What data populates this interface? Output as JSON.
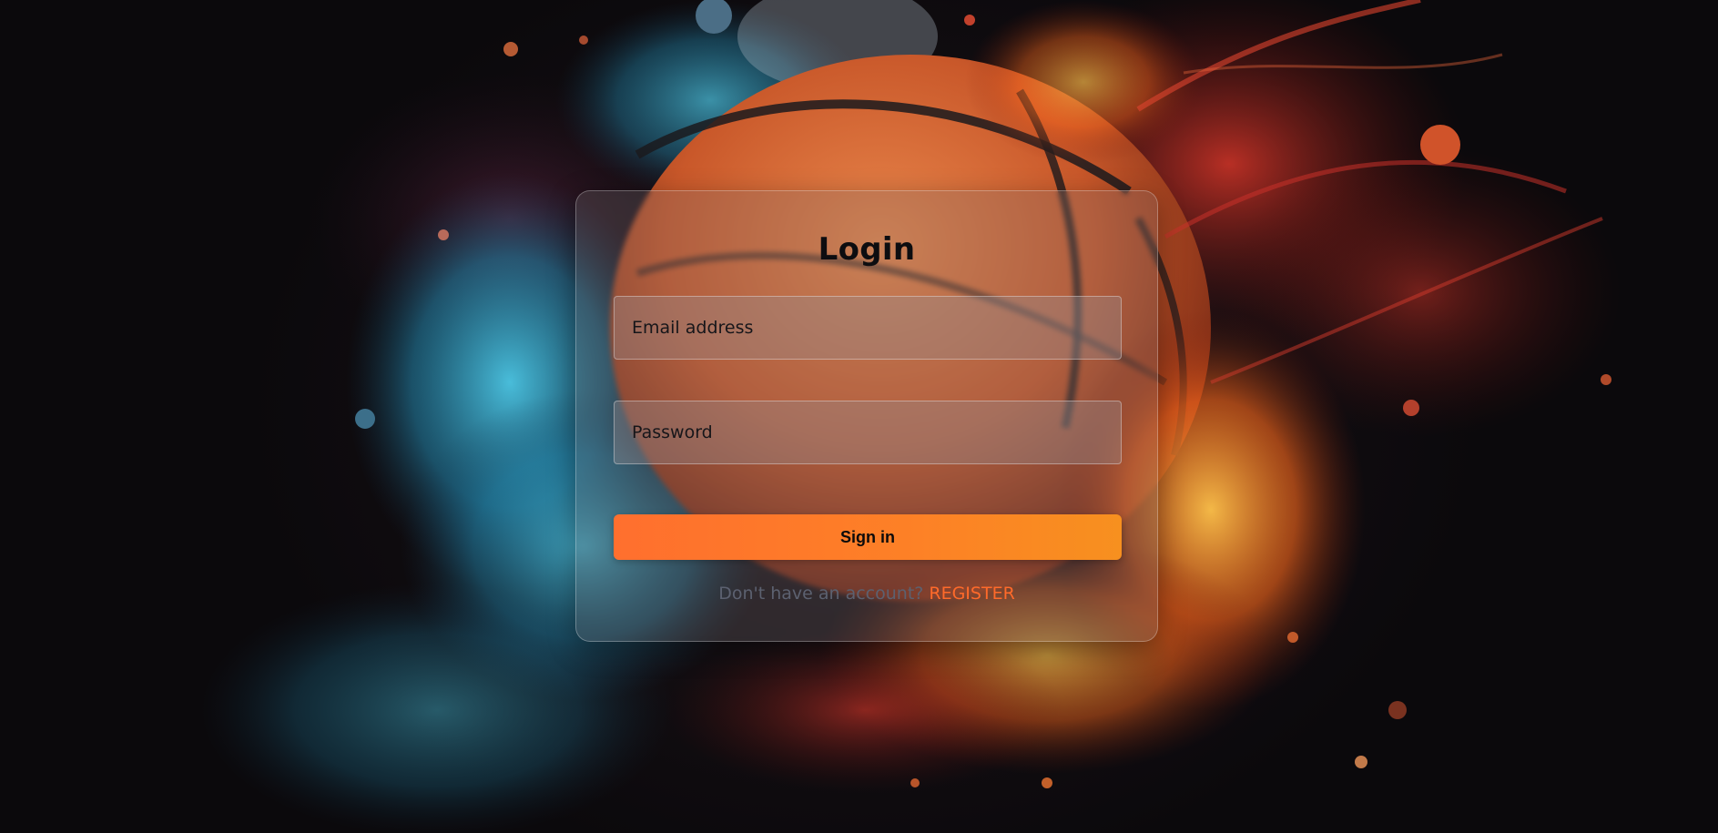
{
  "login": {
    "title": "Login",
    "email_placeholder": "Email address",
    "password_placeholder": "Password",
    "signin_label": "Sign in",
    "register_prompt": "Don't have an account?",
    "register_link": "REGISTER"
  },
  "colors": {
    "accent": "#ff7a2c",
    "link": "#ff6a2a",
    "title": "#0d0d10"
  },
  "background": {
    "image": "basketball-exploding-in-blue-and-orange-smoke"
  }
}
